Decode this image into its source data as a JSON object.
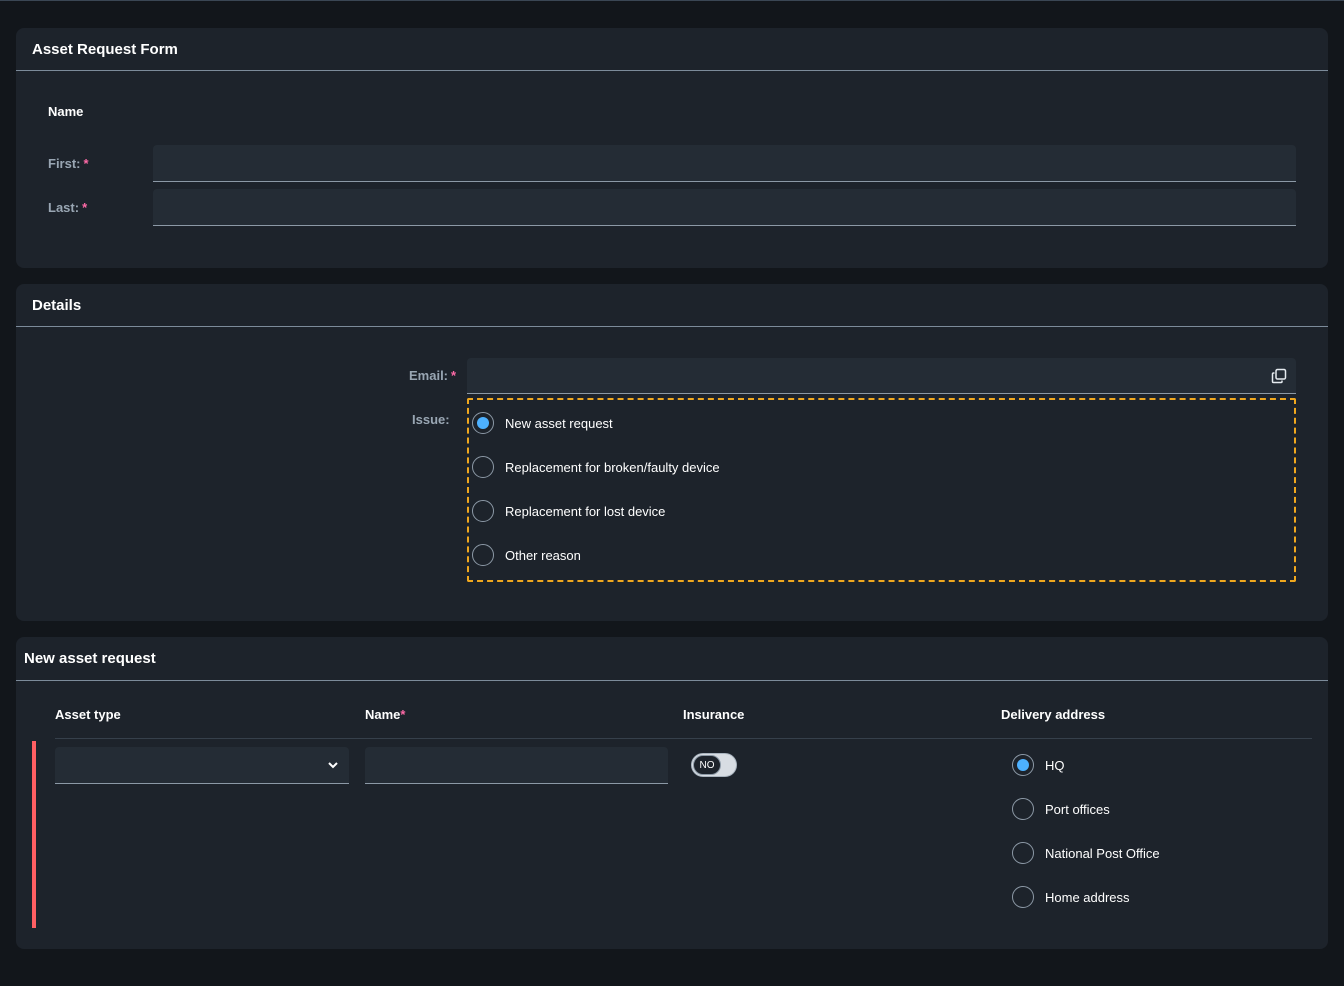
{
  "form": {
    "title": "Asset Request Form",
    "name_group": {
      "title": "Name",
      "first_label": "First:",
      "last_label": "Last:",
      "first_value": "",
      "last_value": "",
      "required_mark": "*"
    }
  },
  "details": {
    "title": "Details",
    "email_label": "Email:",
    "email_value": "",
    "issue_label": "Issue:",
    "issue_options": [
      {
        "label": "New asset request",
        "checked": true
      },
      {
        "label": "Replacement for broken/faulty device",
        "checked": false
      },
      {
        "label": "Replacement for lost device",
        "checked": false
      },
      {
        "label": "Other reason",
        "checked": false
      }
    ],
    "required_mark": "*",
    "icons": {
      "email_action": "copy-icon"
    }
  },
  "new_asset": {
    "title": "New asset request",
    "columns": {
      "asset_type": "Asset type",
      "name": "Name",
      "insurance": "Insurance",
      "delivery": "Delivery address"
    },
    "required_mark": "*",
    "row": {
      "asset_type_value": "",
      "name_value": "",
      "insurance_toggle": "NO",
      "delivery_options": [
        {
          "label": "HQ",
          "checked": true
        },
        {
          "label": "Port offices",
          "checked": false
        },
        {
          "label": "National Post Office",
          "checked": false
        },
        {
          "label": "Home address",
          "checked": false
        }
      ]
    },
    "icons": {
      "dropdown": "chevron-down-icon"
    }
  },
  "colors": {
    "accent": "#4db1ff",
    "required": "#ff6aa7",
    "focus_outline": "#f0a81e",
    "error": "#ff5f63"
  }
}
